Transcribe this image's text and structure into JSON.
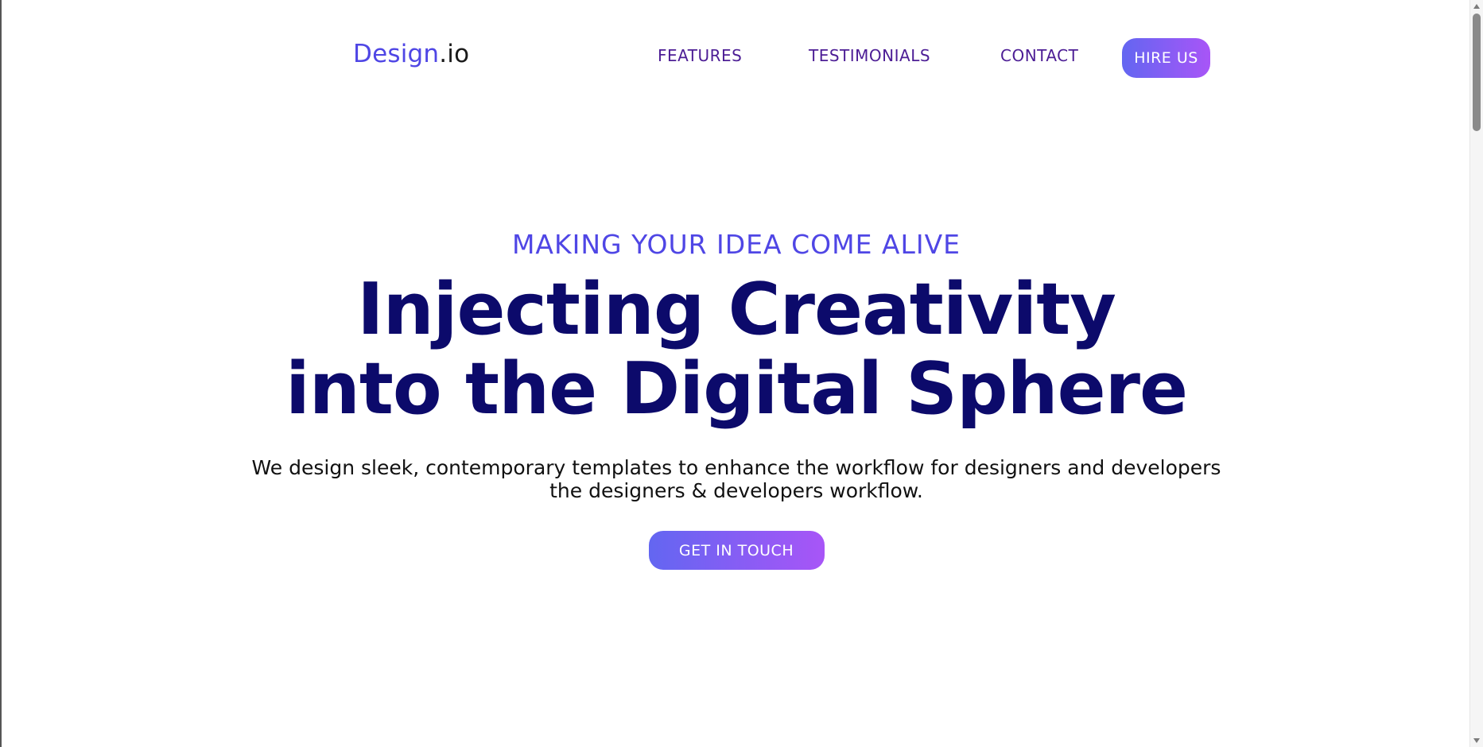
{
  "navbar": {
    "logo_brand": "Design",
    "logo_suffix": ".io",
    "links": [
      {
        "label": "FEATURES"
      },
      {
        "label": "TESTIMONIALS"
      },
      {
        "label": "CONTACT"
      }
    ],
    "hire_label": "HIRE US"
  },
  "hero": {
    "eyebrow": "MAKING YOUR IDEA COME ALIVE",
    "headline_line1": "Injecting Creativity",
    "headline_line2": "into the Digital Sphere",
    "description_line1": "We design sleek, contemporary templates to enhance the workflow for designers and developers",
    "description_line2": "the designers & developers workflow.",
    "cta_label": "GET IN TOUCH"
  },
  "colors": {
    "accent": "#4f46e5",
    "nav_link": "#4c1d95",
    "headline": "#0c0a6b",
    "gradient_start": "#6366f1",
    "gradient_end": "#a855f7"
  }
}
